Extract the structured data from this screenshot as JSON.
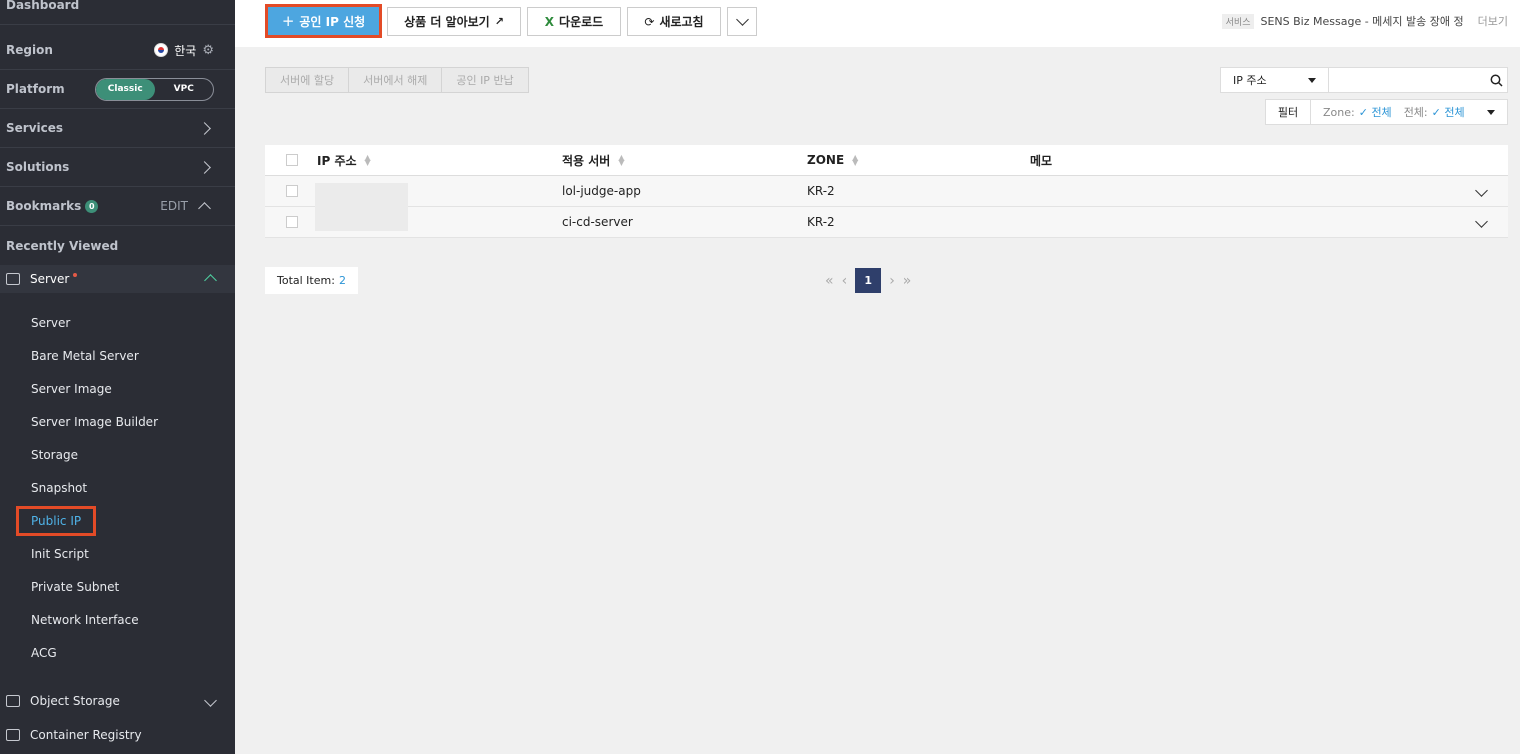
{
  "sidebar": {
    "dashboard": "Dashboard",
    "region_label": "Region",
    "region_value": "한국",
    "platform_label": "Platform",
    "platform_classic": "Classic",
    "platform_vpc": "VPC",
    "services": "Services",
    "solutions": "Solutions",
    "bookmarks": "Bookmarks",
    "bookmarks_count": "0",
    "bookmarks_edit": "EDIT",
    "recently_viewed": "Recently Viewed",
    "server_group": "Server",
    "items": [
      {
        "label": "Server"
      },
      {
        "label": "Bare Metal Server"
      },
      {
        "label": "Server Image"
      },
      {
        "label": "Server Image Builder"
      },
      {
        "label": "Storage"
      },
      {
        "label": "Snapshot"
      },
      {
        "label": "Public IP",
        "active": true
      },
      {
        "label": "Init Script"
      },
      {
        "label": "Private Subnet"
      },
      {
        "label": "Network Interface"
      },
      {
        "label": "ACG"
      }
    ],
    "object_storage": "Object Storage",
    "container_registry": "Container Registry"
  },
  "toolbar": {
    "create_label": "공인 IP 신청",
    "learn_more_label": "상품 더 알아보기",
    "download_label": "다운로드",
    "refresh_label": "새로고침"
  },
  "notice": {
    "tag": "서비스",
    "text": "SENS Biz Message - 메세지 발송 장애 정",
    "more": "더보기"
  },
  "actions": {
    "assign": "서버에 할당",
    "release": "서버에서 해제",
    "return": "공인 IP 반납"
  },
  "search": {
    "field": "IP 주소",
    "placeholder": ""
  },
  "filter": {
    "button": "필터",
    "zone_label": "Zone:",
    "zone_value": "전체",
    "all_label": "전체:",
    "all_value": "전체"
  },
  "table": {
    "headers": {
      "ip": "IP 주소",
      "server": "적용 서버",
      "zone": "ZONE",
      "memo": "메모"
    },
    "rows": [
      {
        "ip": "",
        "server": "lol-judge-app",
        "zone": "KR-2",
        "memo": ""
      },
      {
        "ip": "",
        "server": "ci-cd-server",
        "zone": "KR-2",
        "memo": ""
      }
    ]
  },
  "footer": {
    "total_label": "Total Item:",
    "total_count": "2",
    "current_page": "1"
  },
  "colors": {
    "sidebar_bg": "#2b2d35",
    "primary": "#4da6e0",
    "highlight": "#e34b27",
    "accent_green": "#3d8f78",
    "link_blue": "#2d95d6"
  }
}
